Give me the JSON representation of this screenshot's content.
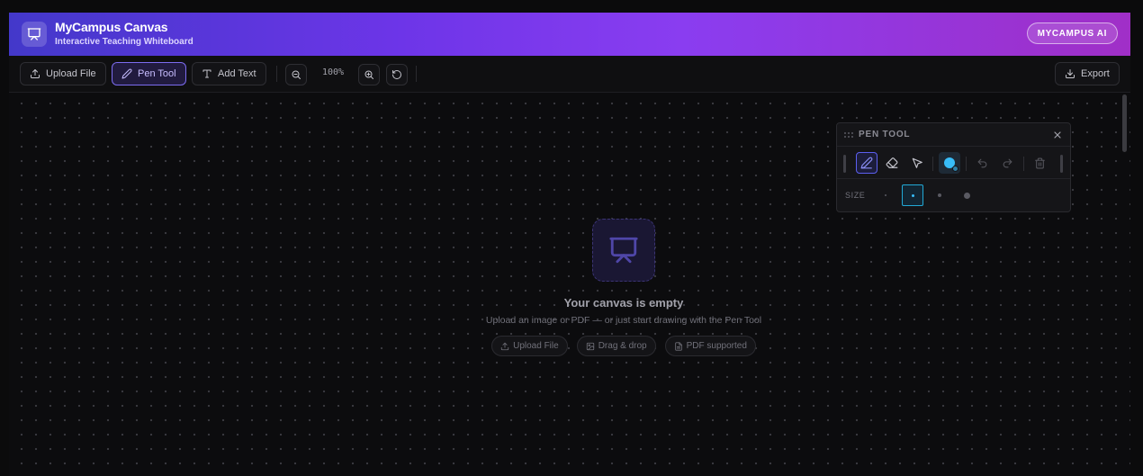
{
  "header": {
    "app_title": "MyCampus Canvas",
    "app_subtitle": "Interactive Teaching Whiteboard",
    "ai_button": "MYCAMPUS AI",
    "gradient_colors": [
      "#4338ca",
      "#8a3df0",
      "#a02fc7"
    ]
  },
  "toolbar": {
    "upload_label": "Upload File",
    "pen_label": "Pen Tool",
    "text_label": "Add Text",
    "zoom_level": "100%",
    "export_label": "Export",
    "active_tool": "pen"
  },
  "canvas": {
    "empty_title": "Your canvas is empty",
    "empty_subtitle": "Upload an image or PDF — or just start drawing with the Pen Tool",
    "chips": [
      "Upload File",
      "Drag & drop",
      "PDF supported"
    ]
  },
  "pen_panel": {
    "title": "PEN TOOL",
    "size_label": "SIZE",
    "active_color": "#38bdf8",
    "active_size_index": 1
  },
  "icons": [
    "presentation-icon",
    "upload-icon",
    "pen-icon",
    "text-icon",
    "zoom-out-icon",
    "zoom-in-icon",
    "reset-icon",
    "download-icon",
    "eraser-icon",
    "pointer-icon",
    "undo-icon",
    "redo-icon",
    "trash-icon",
    "close-icon",
    "grip-icon",
    "image-icon",
    "file-icon"
  ]
}
